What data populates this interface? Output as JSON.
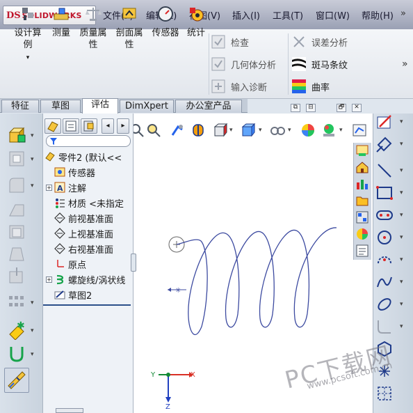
{
  "app": {
    "logo_text": "SOLIDWORKS"
  },
  "menu": {
    "items": [
      "文件(F)",
      "编辑(E)",
      "视图(V)",
      "插入(I)",
      "工具(T)",
      "窗口(W)",
      "帮助(H)"
    ],
    "pin_label": "»"
  },
  "ribbon": {
    "design_study": "设计算例",
    "measure": "测量",
    "mass_properties": "质量属性",
    "section_properties": "剖面属性",
    "sensors": "传感器",
    "statistics": "统计",
    "check": "检查",
    "geometry_analysis": "几何体分析",
    "import_diagnostics": "输入诊断",
    "deviation_analysis": "误差分析",
    "zebra_stripes": "斑马条纹",
    "curvature": "曲率",
    "more": "»"
  },
  "tabs": [
    {
      "label": "特征",
      "active": false
    },
    {
      "label": "草图",
      "active": false
    },
    {
      "label": "评估",
      "active": true
    },
    {
      "label": "DimXpert",
      "active": false
    },
    {
      "label": "办公室产品",
      "active": false
    }
  ],
  "window_controls": [
    "⧉",
    "⊟",
    "🗗",
    "✕"
  ],
  "tree": {
    "root": "零件2 (默认<<",
    "items": [
      {
        "label": "传感器",
        "icon": "sensor-icon",
        "expandable": false
      },
      {
        "label": "注解",
        "icon": "annotation-icon",
        "expandable": true
      },
      {
        "label": "材质 <未指定",
        "icon": "material-icon",
        "expandable": false
      },
      {
        "label": "前视基准面",
        "icon": "plane-icon",
        "expandable": false
      },
      {
        "label": "上视基准面",
        "icon": "plane-icon",
        "expandable": false
      },
      {
        "label": "右视基准面",
        "icon": "plane-icon",
        "expandable": false
      },
      {
        "label": "原点",
        "icon": "origin-icon",
        "expandable": false
      },
      {
        "label": "螺旋线/涡状线",
        "icon": "helix-icon",
        "expandable": true
      },
      {
        "label": "草图2",
        "icon": "sketch-icon",
        "expandable": false
      }
    ]
  },
  "triad": {
    "x_label": "X",
    "y_label": "Y",
    "z_label": "Z"
  },
  "watermark": {
    "text": "PC下载网",
    "url": "www.pcsoft.com.cn"
  },
  "colors": {
    "accent_blue": "#2b3ea8",
    "logo_red": "#c0172d",
    "helix": "#3c4aa0"
  }
}
